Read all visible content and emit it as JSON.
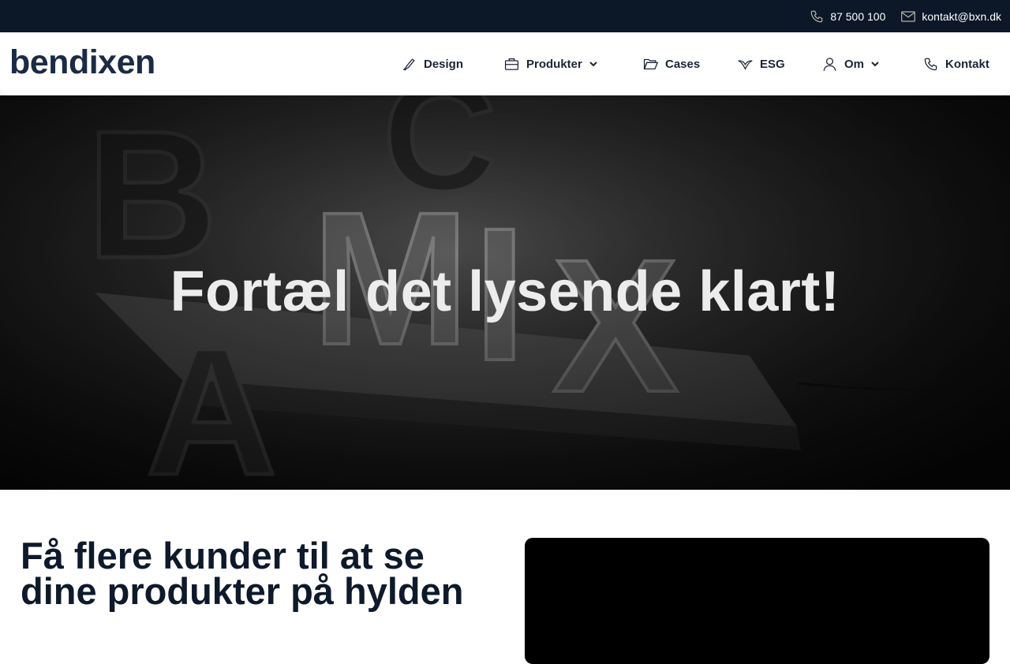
{
  "topbar": {
    "phone": "87 500 100",
    "email": "kontakt@bxn.dk",
    "phone_icon": "phone-icon",
    "email_icon": "envelope-icon"
  },
  "header": {
    "logo": "bendixen",
    "nav": [
      {
        "label": "Design",
        "icon": "pen-icon",
        "dropdown": false
      },
      {
        "label": "Produkter",
        "icon": "briefcase-icon",
        "dropdown": true
      },
      {
        "label": "Cases",
        "icon": "folder-icon",
        "dropdown": false
      },
      {
        "label": "ESG",
        "icon": "leaf-icon",
        "dropdown": false
      },
      {
        "label": "Om",
        "icon": "user-icon",
        "dropdown": true
      },
      {
        "label": "Kontakt",
        "icon": "phone-icon",
        "dropdown": false
      }
    ]
  },
  "hero": {
    "title": "Fortæl det lysende klart!",
    "background_letters": [
      "B",
      "C",
      "M",
      "I",
      "X",
      "A"
    ]
  },
  "content": {
    "heading": "Få flere kunder til at se dine produkter på hylden"
  },
  "colors": {
    "topbar_bg": "#0c1828",
    "logo": "#1b2b44",
    "heading": "#0e1a2b"
  }
}
